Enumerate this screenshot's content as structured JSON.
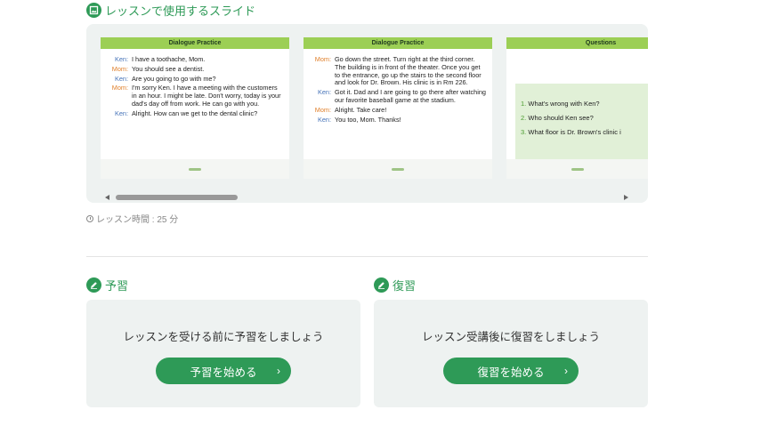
{
  "slides_section": {
    "title": "レッスンで使用するスライド",
    "icon": "slides-icon"
  },
  "slides": [
    {
      "header": "Dialogue Practice",
      "lines": [
        {
          "speaker": "Ken:",
          "text": "I have a toothache, Mom."
        },
        {
          "speaker": "Mom:",
          "text": "You should see a dentist."
        },
        {
          "speaker": "Ken:",
          "text": "Are you going to go with me?"
        },
        {
          "speaker": "Mom:",
          "text": "I'm sorry Ken. I have a meeting with the customers in an hour. I might be late. Don't worry, today is your dad's day off from work. He can go with you."
        },
        {
          "speaker": "Ken:",
          "text": "Alright. How can we get to the dental clinic?"
        }
      ]
    },
    {
      "header": "Dialogue Practice",
      "lines": [
        {
          "speaker": "Mom:",
          "text": "Go down the street. Turn right at the third corner. The building is in front of the theater. Once you get to the entrance, go up the stairs to the second floor and look for Dr. Brown. His clinic is in Rm 226."
        },
        {
          "speaker": "Ken:",
          "text": "Got it. Dad and I are going to go there after watching our favorite baseball game at the stadium."
        },
        {
          "speaker": "Mom:",
          "text": "Alright. Take care!"
        },
        {
          "speaker": "Ken:",
          "text": "You too, Mom. Thanks!"
        }
      ]
    },
    {
      "header": "Questions",
      "questions": [
        {
          "num": "1.",
          "text": "What's wrong with Ken?"
        },
        {
          "num": "2.",
          "text": "Who should Ken see?"
        },
        {
          "num": "3.",
          "text": "What floor is Dr. Brown's clinic i"
        }
      ]
    }
  ],
  "lesson_time": {
    "label": "レッスン時間 : 25 分",
    "icon": "clock-icon"
  },
  "preview": {
    "title": "予習",
    "description": "レッスンを受ける前に予習をしましょう",
    "button_label": "予習を始める",
    "icon": "pencil-icon"
  },
  "review": {
    "title": "復習",
    "description": "レッスン受講後に復習をしましょう",
    "button_label": "復習を始める",
    "icon": "pencil-icon"
  },
  "colors": {
    "accent": "#2e9a57",
    "slide_header": "#9ccf55",
    "panel_bg": "#eef2f1"
  }
}
